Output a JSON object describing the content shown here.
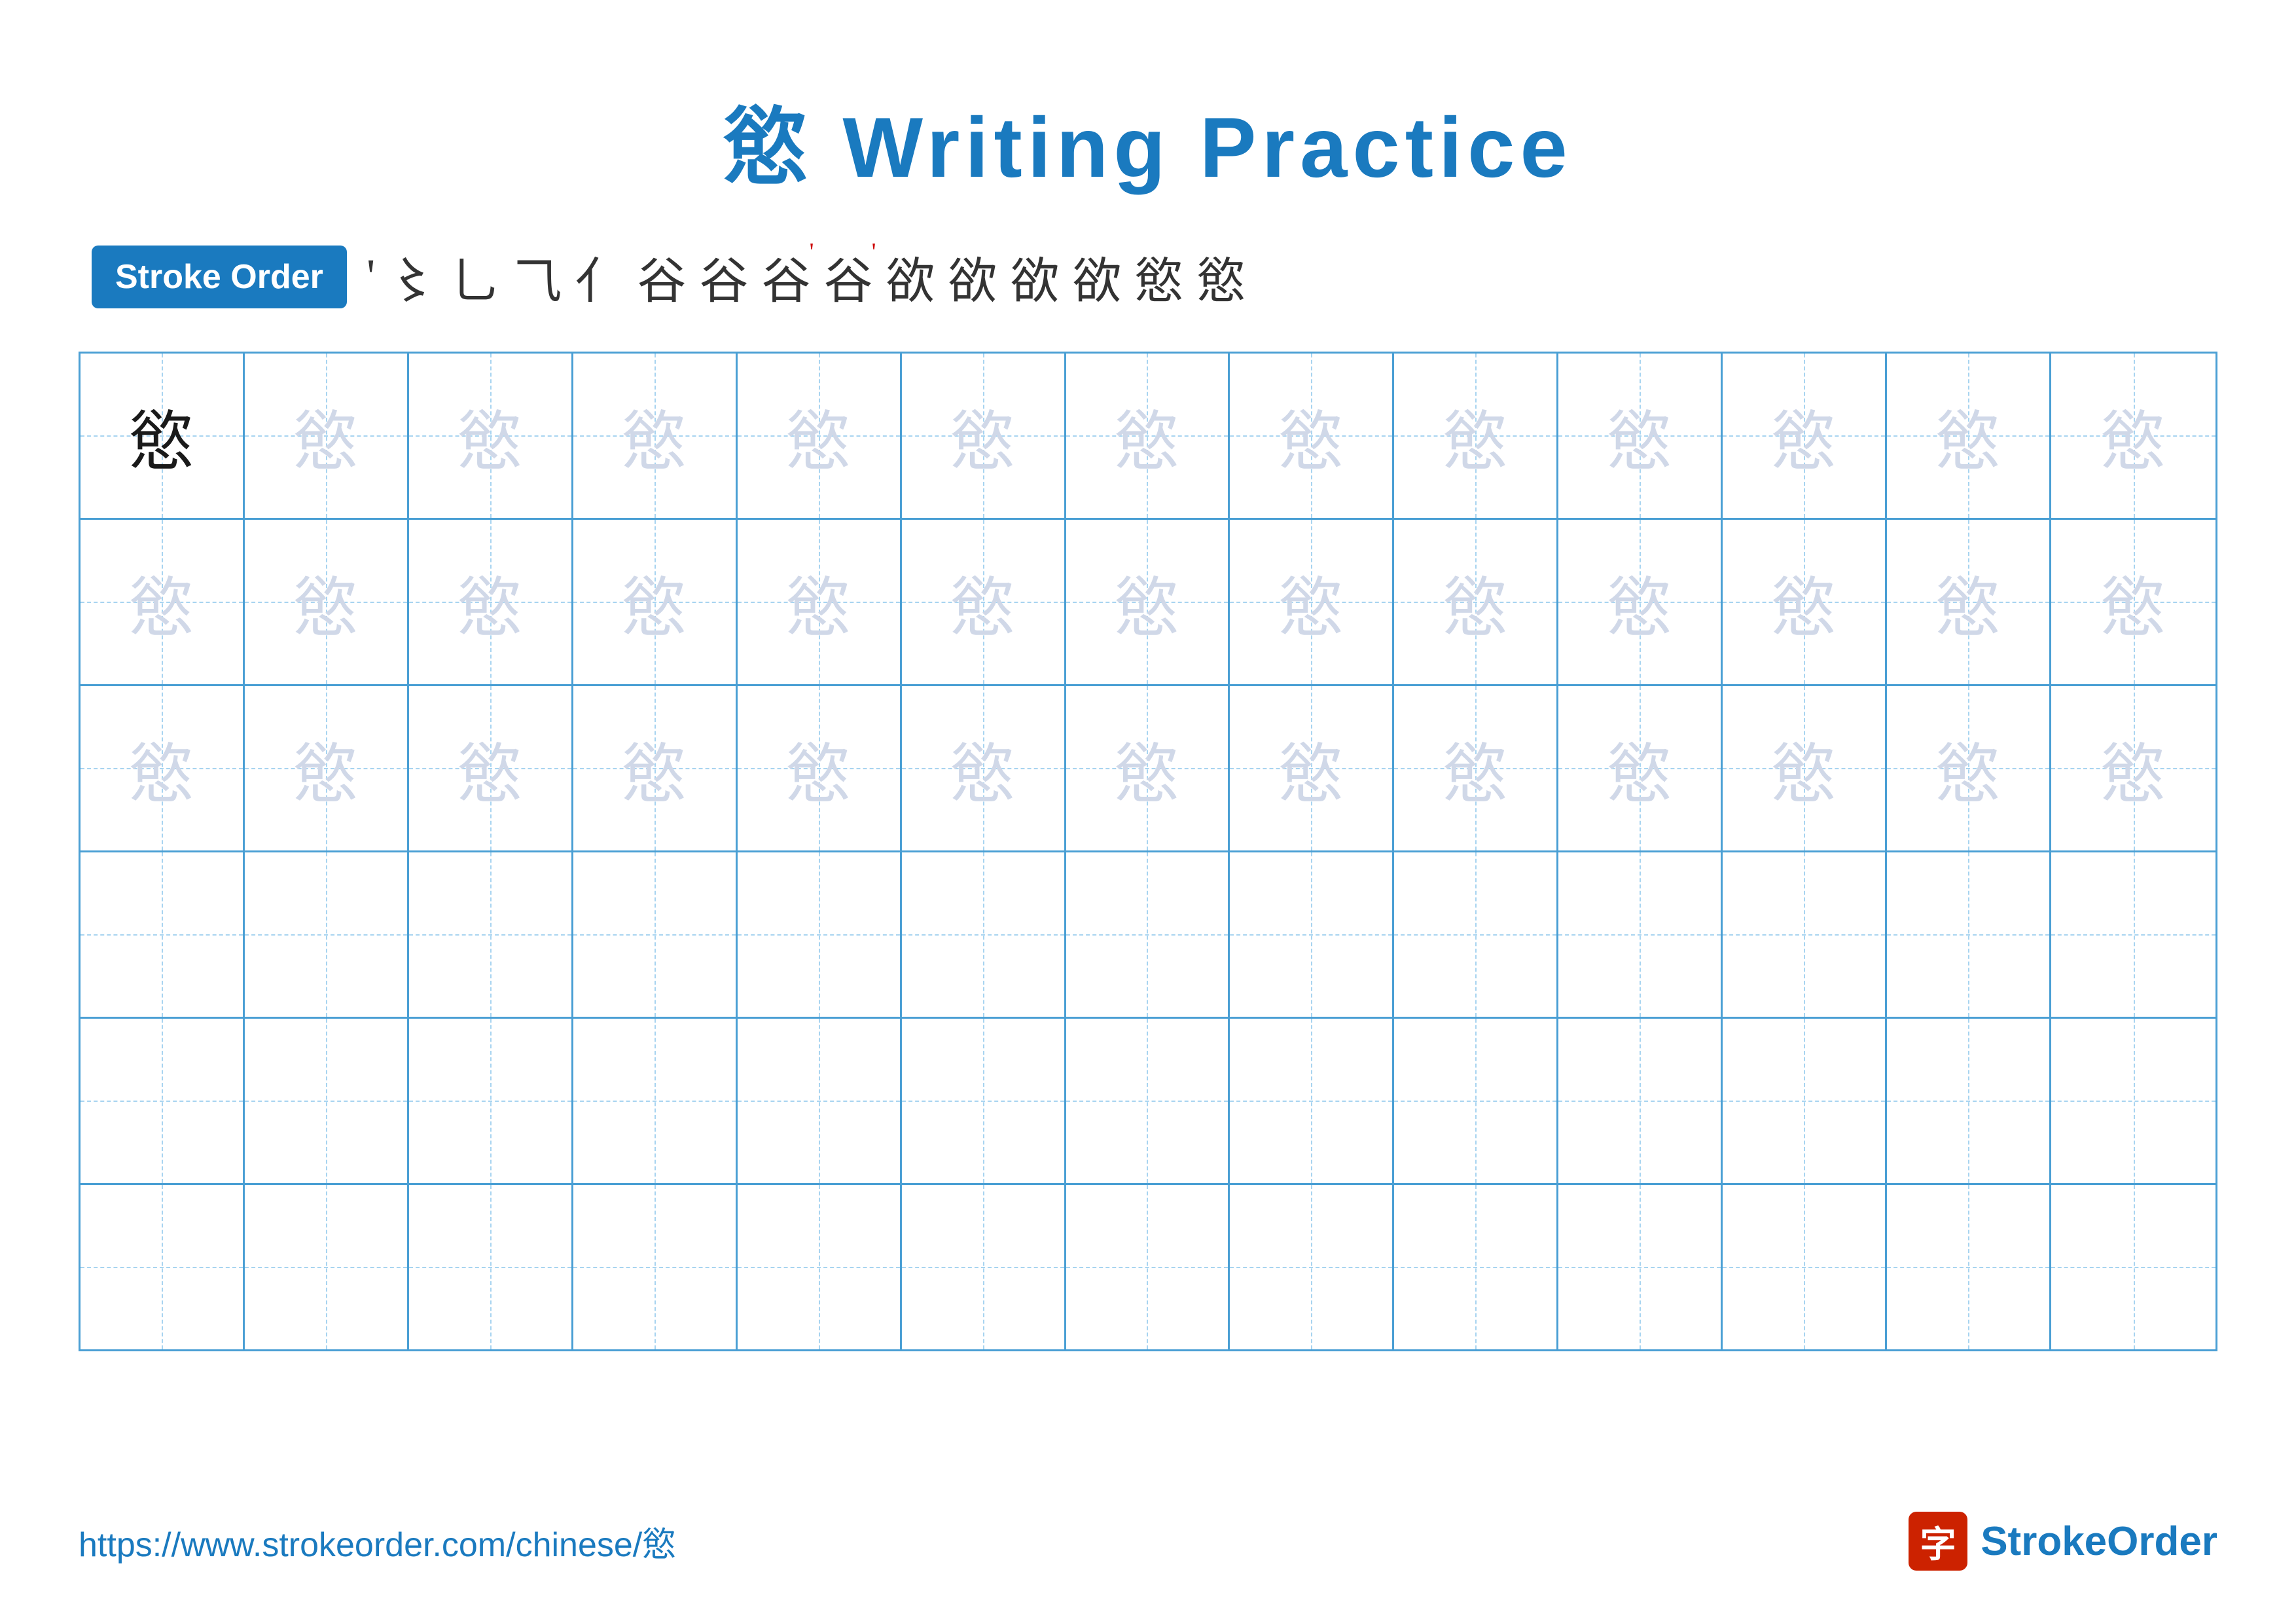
{
  "title": {
    "char": "慾",
    "text": " Writing Practice"
  },
  "stroke_order": {
    "badge_label": "Stroke Order",
    "steps": [
      "'",
      "丷",
      "乙",
      "乙",
      "乙",
      "谷",
      "谷",
      "谷'",
      "谷'",
      "欲",
      "欲",
      "欲",
      "欲",
      "慾",
      "慾"
    ]
  },
  "grid": {
    "rows": 6,
    "cols": 13,
    "character": "慾",
    "row_patterns": [
      "dark,light,light,light,light,light,light,light,light,light,light,light,light",
      "light,light,light,light,light,light,light,light,light,light,light,light,light",
      "light,light,light,light,light,light,light,light,light,light,light,light,light",
      "empty,empty,empty,empty,empty,empty,empty,empty,empty,empty,empty,empty,empty",
      "empty,empty,empty,empty,empty,empty,empty,empty,empty,empty,empty,empty,empty",
      "empty,empty,empty,empty,empty,empty,empty,empty,empty,empty,empty,empty,empty"
    ]
  },
  "footer": {
    "url": "https://www.strokeorder.com/chinese/慾",
    "logo_char": "字",
    "logo_text": "StrokeOrder"
  }
}
